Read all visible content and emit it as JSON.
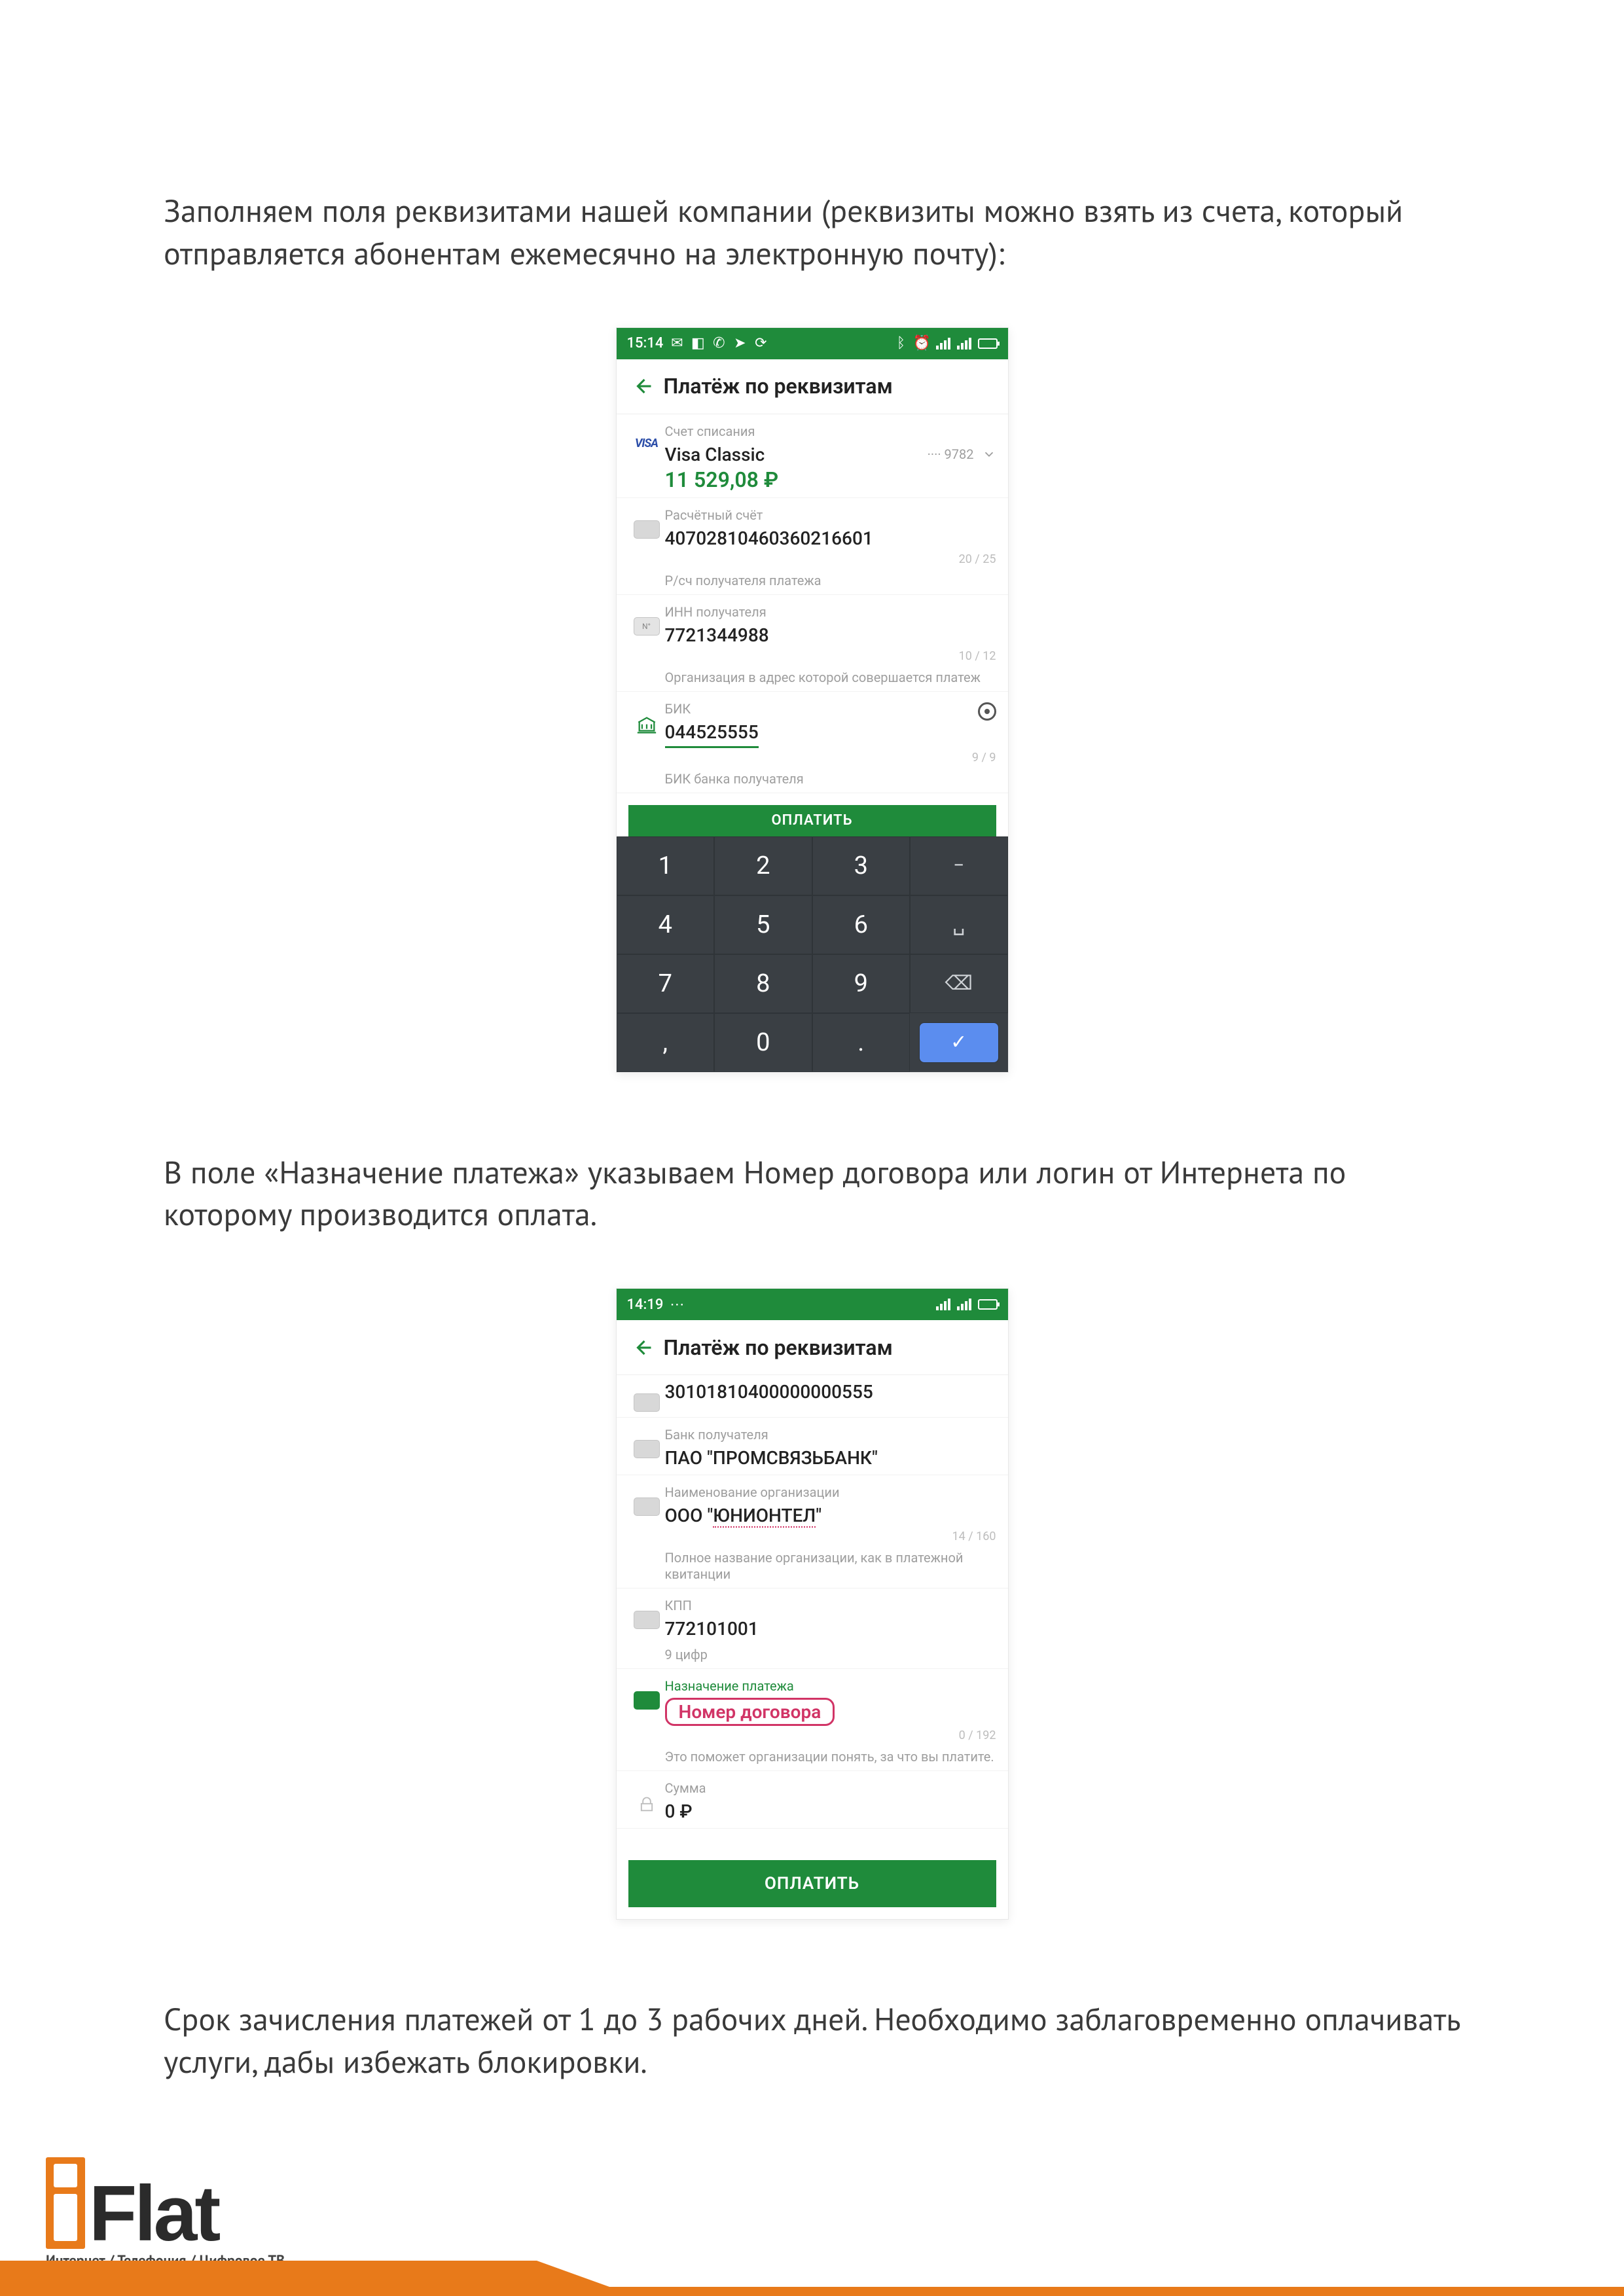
{
  "paragraphs": {
    "p1": "Заполняем поля реквизитами нашей компании (реквизиты можно взять из счета, который отправляется абонентам ежемесячно на электронную почту):",
    "p2": "В поле «Назначение платежа» указываем Номер договора или логин от Интернета по которому производится оплата.",
    "p3": "Срок зачисления платежей от 1 до 3 рабочих дней. Необходимо заблаговременно оплачивать услуги, дабы избежать блокировки."
  },
  "screenshot1": {
    "status_time": "15:14",
    "app_title": "Платёж по реквизитам",
    "card": {
      "label": "Счет списания",
      "name": "Visa Classic",
      "last4": "···· 9782",
      "balance": "11 529,08 ₽"
    },
    "account": {
      "label": "Расчётный счёт",
      "value": "40702810460360216601",
      "count": "20 / 25",
      "note": "Р/сч получателя платежа"
    },
    "inn": {
      "label": "ИНН получателя",
      "value": "7721344988",
      "count": "10 / 12",
      "note": "Организация в адрес которой совершается платеж"
    },
    "bik": {
      "label": "БИК",
      "value": "044525555",
      "count": "9 / 9",
      "note": "БИК банка получателя"
    },
    "pay_label": "ОПЛАТИТЬ",
    "keypad": [
      "1",
      "2",
      "3",
      "−",
      "4",
      "5",
      "6",
      "␣",
      "7",
      "8",
      "9",
      "⌫",
      ",",
      "0",
      ".",
      "✓"
    ]
  },
  "screenshot2": {
    "status_time": "14:19",
    "app_title": "Платёж по реквизитам",
    "acct_value": "30101810400000000555",
    "bank": {
      "label": "Банк получателя",
      "value": "ПАО \"ПРОМСВЯЗЬБАНК\""
    },
    "org": {
      "label": "Наименование организации",
      "value": "ООО \"ЮНИОНТЕЛ\"",
      "count": "14 / 160",
      "note": "Полное название организации, как в платежной квитанции"
    },
    "kpp": {
      "label": "КПП",
      "value": "772101001",
      "note": "9 цифр"
    },
    "purpose": {
      "label": "Назначение платежа",
      "highlight": "Номер договора",
      "count": "0 / 192",
      "note": "Это поможет организации понять, за что вы платите."
    },
    "amount": {
      "label": "Сумма",
      "value": "0 ₽"
    },
    "pay_label": "ОПЛАТИТЬ"
  },
  "footer": {
    "brand": "Flat",
    "tagline": "Интернет / Телефония / Цифровое ТВ"
  }
}
